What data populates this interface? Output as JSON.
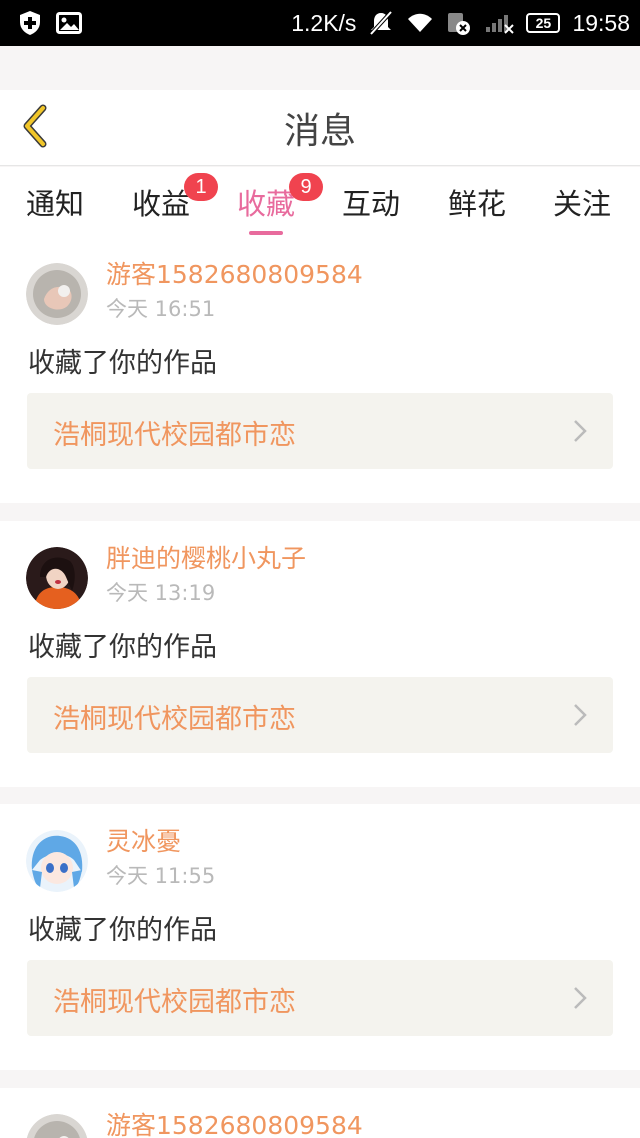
{
  "status_bar": {
    "net_speed": "1.2K/s",
    "battery": "25",
    "time": "19:58",
    "icons": [
      "shield-plus-icon",
      "image-icon",
      "mute-icon",
      "wifi-icon",
      "sim-error-icon",
      "signal-icon",
      "battery-icon"
    ]
  },
  "header": {
    "title": "消息",
    "back_icon": "chevron-left-icon",
    "accent_color": "#f1c62a"
  },
  "tabs": [
    {
      "label": "通知",
      "badge": "",
      "active": false
    },
    {
      "label": "收益",
      "badge": "1",
      "active": false
    },
    {
      "label": "收藏",
      "badge": "9",
      "active": true
    },
    {
      "label": "互动",
      "badge": "",
      "active": false
    },
    {
      "label": "鲜花",
      "badge": "",
      "active": false
    },
    {
      "label": "关注",
      "badge": "",
      "active": false
    }
  ],
  "colors": {
    "active_tab": "#e86b9d",
    "badge": "#f0434f",
    "username": "#f0965f",
    "work_title": "#f0965f",
    "work_box_bg": "#f4f3ee"
  },
  "messages": [
    {
      "user": "游客1582680809584",
      "time": "今天 16:51",
      "action": "收藏了你的作品",
      "work": "浩桐现代校园都市恋"
    },
    {
      "user": "胖迪的樱桃小丸子",
      "time": "今天 13:19",
      "action": "收藏了你的作品",
      "work": "浩桐现代校园都市恋"
    },
    {
      "user": "灵冰憂",
      "time": "今天 11:55",
      "action": "收藏了你的作品",
      "work": "浩桐现代校园都市恋"
    },
    {
      "user": "游客1582680809584",
      "time": "",
      "action": "",
      "work": ""
    }
  ]
}
